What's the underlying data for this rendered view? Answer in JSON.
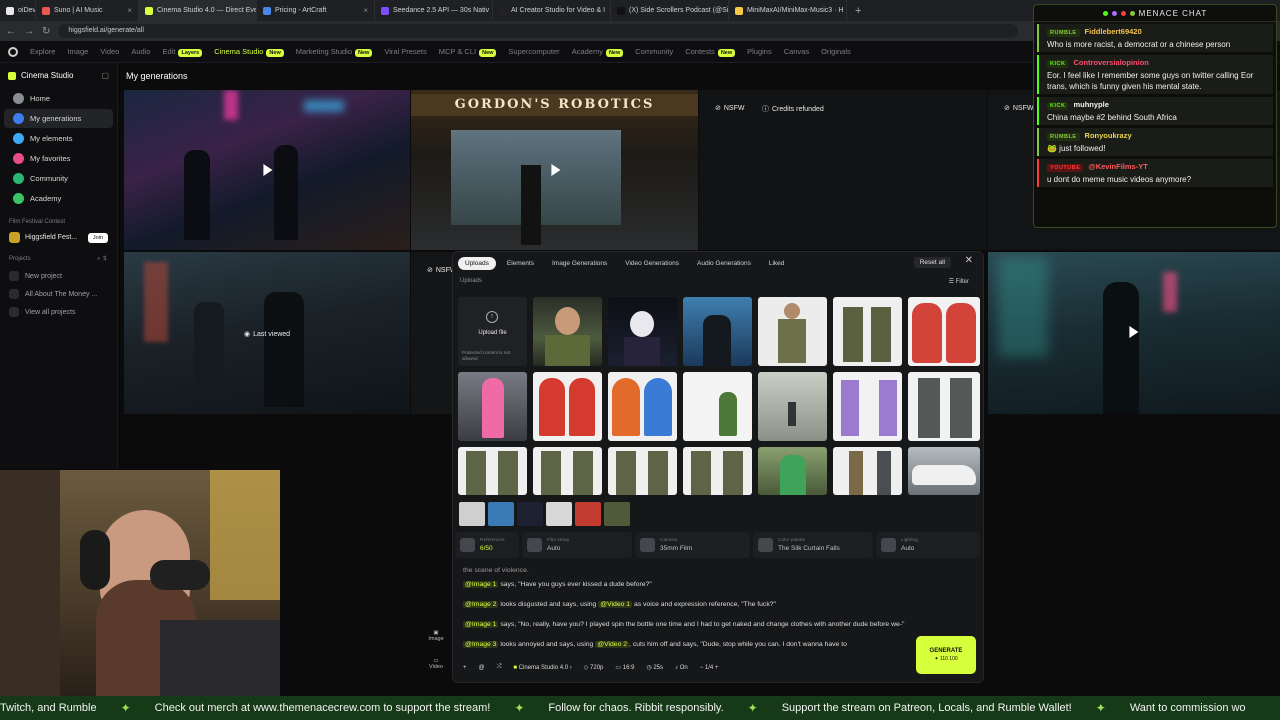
{
  "browser": {
    "tabs": [
      {
        "label": "oiDev",
        "color": "#e8e8e8"
      },
      {
        "label": "Suno | AI Music",
        "color": "#e85a4f"
      },
      {
        "label": "Cinema Studio 4.0 — Direct Eve",
        "color": "#d6ff3c"
      },
      {
        "label": "Pricing - ArtCraft",
        "color": "#4a86e8"
      },
      {
        "label": "Seedance 2.5 API — 30s Nativ",
        "color": "#7c4dff"
      },
      {
        "label": "AI Creator Studio for Video & I",
        "color": "#222222"
      },
      {
        "label": "(X) Side Scrollers Podcast (@Si",
        "color": "#111111"
      },
      {
        "label": "MiniMaxAI/MiniMax-Music3 · H",
        "color": "#f6c945"
      }
    ],
    "new_tab": "+",
    "url": "higgsfield.ai/generate/all",
    "ask": "Ask Gemini"
  },
  "sitenav": {
    "items": [
      "Explore",
      "Image",
      "Video",
      "Audio",
      "Edit",
      "Cinema Studio",
      "Marketing Studio",
      "Viral Presets",
      "MCP & CLI",
      "Supercomputer",
      "Academy",
      "Community",
      "Contests",
      "Plugins",
      "Canvas",
      "Originals"
    ],
    "badge_layers": "Layers",
    "badge_new": "New"
  },
  "sidebar": {
    "title": "Cinema Studio",
    "items": [
      {
        "label": "Home",
        "color": "#8a8d93"
      },
      {
        "label": "My generations",
        "color": "#3d7df0"
      },
      {
        "label": "My elements",
        "color": "#3fa9f5"
      },
      {
        "label": "My favorites",
        "color": "#e84c8a"
      },
      {
        "label": "Community",
        "color": "#2bb673"
      },
      {
        "label": "Academy",
        "color": "#3cc36a"
      }
    ],
    "festival_section": "Film Festival Contest",
    "festival_name": "Higgsfield Fest...",
    "join": "Join",
    "projects_section": "Projects",
    "projects": [
      "New project",
      "All About The Money ...",
      "View all projects"
    ]
  },
  "page_title": "My generations",
  "tiles": {
    "nsfw": "NSFW",
    "credits_refunded": "Credits refunded",
    "last_viewed": "Last viewed",
    "sign_text": "GORDON'S ROBOTICS"
  },
  "modal": {
    "tabs": [
      "Uploads",
      "Elements",
      "Image Generations",
      "Video Generations",
      "Audio Generations",
      "Liked"
    ],
    "reset": "Reset all",
    "close": "✕",
    "section": "Uploads",
    "filter": "Filter",
    "upload_label": "Upload file",
    "upload_warning": "Protected content is not allowed",
    "settings": [
      {
        "label": "References",
        "value": "6/50"
      },
      {
        "label": "Film setup",
        "value": "Auto"
      },
      {
        "label": "Camera",
        "value": "35mm Film"
      },
      {
        "label": "Color palette",
        "value": "The Silk Curtain Falls"
      },
      {
        "label": "Lighting",
        "value": "Auto"
      }
    ],
    "prompt_top": "the scene of violence.",
    "prompt_lines": [
      {
        "tag": "@Image 1",
        "text": " says, \"Have you guys ever kissed a dude before?\""
      },
      {
        "tag": "@Image 2",
        "text": " looks disgusted and says, using ",
        "tag2": "@Video 1",
        "text2": " as voice and expression reference, \"The fuck?\""
      },
      {
        "tag": "@Image 1",
        "text": " says, \"No, really, have you? I played spin the bottle one time and I had to get naked and change clothes with another dude before we-\""
      },
      {
        "tag": "@Image 3",
        "text": " looks annoyed and says, using ",
        "tag2": "@Video 2",
        "text2": ", cuts him off and says, \"Dude, stop while you can. I don't wanna have to"
      }
    ],
    "bottom": {
      "model": "Cinema Studio 4.0",
      "resolution": "720p",
      "ratio": "16:9",
      "duration": "25s",
      "audio": "On",
      "count": "1/4"
    },
    "side_image": "Image",
    "side_video": "Video",
    "generate": "GENERATE",
    "generate_cost": "✦ 110 100"
  },
  "chat": {
    "title": "MENACE CHAT",
    "messages": [
      {
        "platform": "RUMBLE",
        "pcolor": "#85c742",
        "user": "Fiddlebert69420",
        "ucolor": "#f2c14e",
        "text": "Who is more racist, a democrat or a chinese person"
      },
      {
        "platform": "KICK",
        "pcolor": "#53fc18",
        "user": "Controversialopinion",
        "ucolor": "#ff4d6d",
        "text": "Eor. I feel like I remember some guys on twitter calling Eor trans, which is funny given his mental state."
      },
      {
        "platform": "KICK",
        "pcolor": "#53fc18",
        "user": "muhnyple",
        "ucolor": "#f5f5f5",
        "text": "China maybe #2 behind South Africa"
      },
      {
        "platform": "RUMBLE",
        "pcolor": "#85c742",
        "user": "Ronyoukrazy",
        "ucolor": "#e8d84a",
        "text": "🐸 just followed!"
      },
      {
        "platform": "YOUTUBE",
        "pcolor": "#ff3b3b",
        "user": "@KevinFilms-YT",
        "ucolor": "#ff5a5a",
        "text": "u dont do meme music videos anymore?"
      }
    ]
  },
  "ticker": [
    "Twitch, and Rumble",
    "Check out merch at www.themenacecrew.com to support the stream!",
    "Follow for chaos. Ribbit responsibly.",
    "Support the stream on Patreon, Locals, and Rumble Wallet!",
    "Want to commission wo"
  ]
}
